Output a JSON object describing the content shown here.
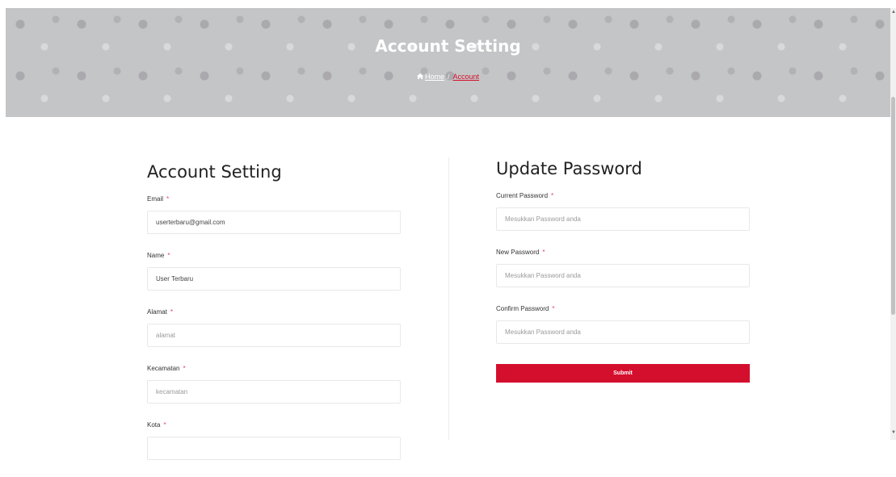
{
  "hero": {
    "title": "Account Setting",
    "breadcrumb": {
      "home_icon": "home-icon",
      "home": "Home",
      "separator": "/",
      "current": "Account"
    }
  },
  "account": {
    "title": "Account Setting",
    "fields": [
      {
        "label": "Email",
        "required": "*",
        "value": "userterbaru@gmail.com",
        "placeholder": ""
      },
      {
        "label": "Name",
        "required": "*",
        "value": "User Terbaru",
        "placeholder": ""
      },
      {
        "label": "Alamat",
        "required": "*",
        "value": "",
        "placeholder": "alamat"
      },
      {
        "label": "Kecamatan",
        "required": "*",
        "value": "",
        "placeholder": "kecamatan"
      },
      {
        "label": "Kota",
        "required": "*",
        "value": "",
        "placeholder": ""
      }
    ]
  },
  "password": {
    "title": "Update Password",
    "fields": [
      {
        "label": "Current Password",
        "required": "*",
        "placeholder": "Mesukkan Password anda"
      },
      {
        "label": "New Password",
        "required": "*",
        "placeholder": "Mesukkan Password anda"
      },
      {
        "label": "Confirm Password",
        "required": "*",
        "placeholder": "Mesukkan Password anda"
      }
    ],
    "submit_label": "Submit"
  },
  "colors": {
    "accent": "#d40f2d",
    "hero_bg": "#c4c5c7",
    "required": "#e4405f"
  }
}
